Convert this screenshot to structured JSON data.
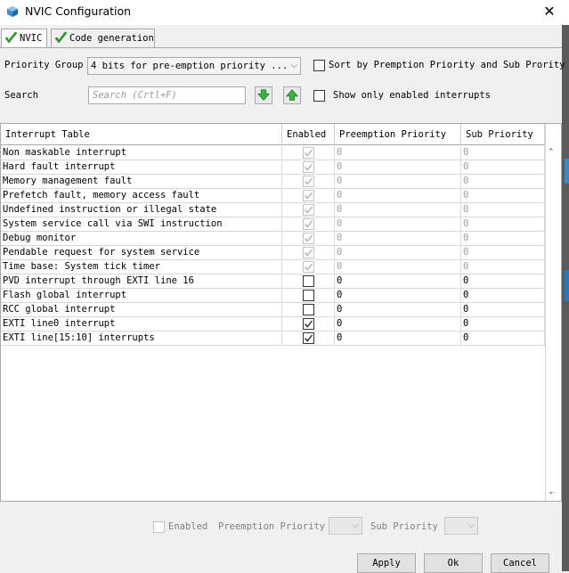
{
  "window": {
    "title": "NVIC Configuration",
    "close_glyph": "✕"
  },
  "tabs": [
    {
      "label": "NVIC",
      "active": true
    },
    {
      "label": "Code generation",
      "active": false
    }
  ],
  "priority_group": {
    "label": "Priority Group",
    "value": "4 bits for pre-emption priority ..."
  },
  "sort_option": {
    "label": "Sort by Premption Priority and Sub Prority",
    "checked": false
  },
  "search": {
    "label": "Search",
    "placeholder": "Search (Crtl+F)",
    "down_icon": "arrow-down-icon",
    "up_icon": "arrow-up-icon"
  },
  "show_enabled": {
    "label": "Show only enabled interrupts",
    "checked": false
  },
  "table": {
    "columns": [
      "Interrupt Table",
      "Enabled",
      "Preemption Priority",
      "Sub Priority"
    ],
    "rows": [
      {
        "name": "Non maskable interrupt",
        "enabled": true,
        "locked": true,
        "preempt": "0",
        "sub": "0"
      },
      {
        "name": "Hard fault interrupt",
        "enabled": true,
        "locked": true,
        "preempt": "0",
        "sub": "0"
      },
      {
        "name": "Memory management fault",
        "enabled": true,
        "locked": true,
        "preempt": "0",
        "sub": "0"
      },
      {
        "name": "Prefetch fault, memory access fault",
        "enabled": true,
        "locked": true,
        "preempt": "0",
        "sub": "0"
      },
      {
        "name": "Undefined instruction or illegal state",
        "enabled": true,
        "locked": true,
        "preempt": "0",
        "sub": "0"
      },
      {
        "name": "System service call via SWI instruction",
        "enabled": true,
        "locked": true,
        "preempt": "0",
        "sub": "0"
      },
      {
        "name": "Debug monitor",
        "enabled": true,
        "locked": true,
        "preempt": "0",
        "sub": "0"
      },
      {
        "name": "Pendable request for system service",
        "enabled": true,
        "locked": true,
        "preempt": "0",
        "sub": "0"
      },
      {
        "name": "Time base: System tick timer",
        "enabled": true,
        "locked": true,
        "preempt": "0",
        "sub": "0"
      },
      {
        "name": "PVD interrupt through EXTI line 16",
        "enabled": false,
        "locked": false,
        "preempt": "0",
        "sub": "0"
      },
      {
        "name": "Flash global interrupt",
        "enabled": false,
        "locked": false,
        "preempt": "0",
        "sub": "0"
      },
      {
        "name": "RCC global interrupt",
        "enabled": false,
        "locked": false,
        "preempt": "0",
        "sub": "0"
      },
      {
        "name": "EXTI line0 interrupt",
        "enabled": true,
        "locked": false,
        "preempt": "0",
        "sub": "0"
      },
      {
        "name": "EXTI line[15:10] interrupts",
        "enabled": true,
        "locked": false,
        "preempt": "0",
        "sub": "0"
      }
    ]
  },
  "footer": {
    "enabled_label": "Enabled",
    "preemption_label": "Preemption Priority",
    "sub_label": "Sub Priority"
  },
  "buttons": {
    "apply": "Apply",
    "ok": "Ok",
    "cancel": "Cancel"
  }
}
